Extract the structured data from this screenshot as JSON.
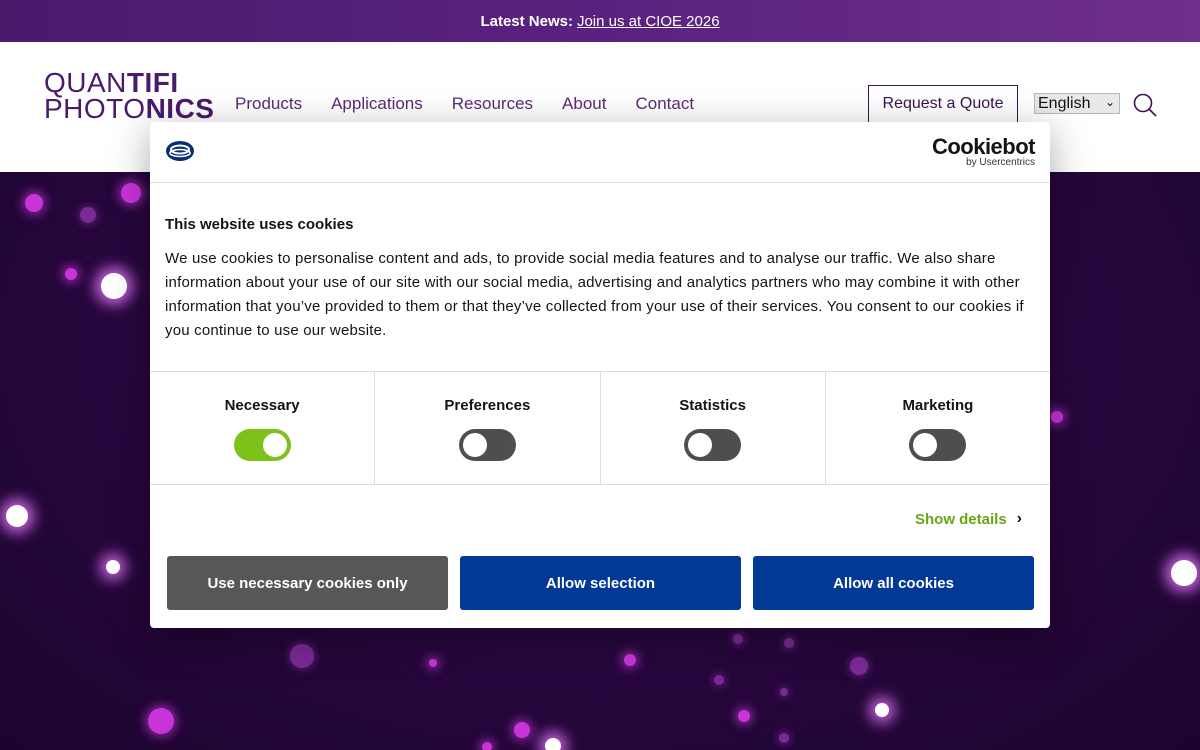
{
  "news_bar": {
    "label": "Latest News:",
    "link_text": "Join us at CIOE 2026"
  },
  "header": {
    "logo": {
      "line1_light": "QUAN",
      "line1_bold": "TIFI",
      "line2_light": "PHOTO",
      "line2_bold": "NICS"
    },
    "nav": [
      {
        "label": "Products"
      },
      {
        "label": "Applications"
      },
      {
        "label": "Resources"
      },
      {
        "label": "About"
      },
      {
        "label": "Contact"
      }
    ],
    "quote_button": "Request a Quote",
    "language": {
      "selected": "English"
    },
    "search_icon": "search-icon"
  },
  "cookie_dialog": {
    "brand": {
      "name": "Cookiebot",
      "sub": "by Usercentrics"
    },
    "title": "This website uses cookies",
    "text": "We use cookies to personalise content and ads, to provide social media features and to analyse our traffic. We also share information about your use of our site with our social media, advertising and analytics partners who may combine it with other information that you’ve provided to them or that they’ve collected from your use of their services. You consent to our cookies if you continue to use our website.",
    "categories": [
      {
        "label": "Necessary",
        "enabled": true
      },
      {
        "label": "Preferences",
        "enabled": false
      },
      {
        "label": "Statistics",
        "enabled": false
      },
      {
        "label": "Marketing",
        "enabled": false
      }
    ],
    "show_details": "Show details",
    "buttons": {
      "necessary_only": "Use necessary cookies only",
      "allow_selection": "Allow selection",
      "allow_all": "Allow all cookies"
    }
  },
  "colors": {
    "brand_purple": "#4a1a6b",
    "toggle_on": "#7dc11b",
    "button_blue": "#023896",
    "button_gray": "#555759",
    "details_green": "#68a614"
  }
}
